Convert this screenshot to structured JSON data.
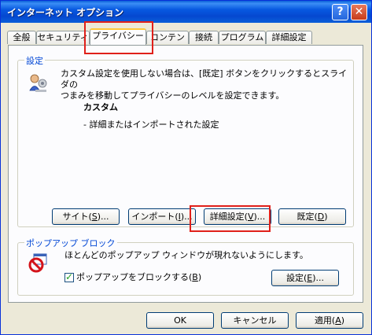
{
  "window": {
    "title": "インターネット オプション"
  },
  "titlebar": {
    "help": "?",
    "close": "✕"
  },
  "tabs": [
    {
      "label": "全般"
    },
    {
      "label": "セキュリティ"
    },
    {
      "label": "プライバシー"
    },
    {
      "label": "コンテンツ"
    },
    {
      "label": "接続"
    },
    {
      "label": "プログラム"
    },
    {
      "label": "詳細設定"
    }
  ],
  "settings": {
    "group_label": "設定",
    "description_line1": "カスタム設定を使用しない場合は、[既定] ボタンをクリックするとスライダの",
    "description_line2": "つまみを移動してプライバシーのレベルを設定できます。",
    "level_title": "カスタム",
    "level_detail": "- 詳細またはインポートされた設定",
    "buttons": {
      "sites": {
        "text": "サイト(",
        "key": "S",
        "end": ")..."
      },
      "import": {
        "text": "インポート(",
        "key": "I",
        "end": ")..."
      },
      "advanced": {
        "text": "詳細設定(",
        "key": "V",
        "end": ")..."
      },
      "default": {
        "text": "既定(",
        "key": "D",
        "end": ")"
      }
    }
  },
  "popup": {
    "group_label": "ポップアップ ブロック",
    "description": "ほとんどのポップアップ ウィンドウが現れないようにします。",
    "checkbox": {
      "text": "ポップアップをブロックする(",
      "key": "B",
      "end": ")",
      "checked": true
    },
    "settings_button": {
      "text": "設定(",
      "key": "E",
      "end": ")..."
    }
  },
  "footer": {
    "ok": "OK",
    "cancel": {
      "text": "キャンセル"
    },
    "apply": {
      "text": "適用(",
      "key": "A",
      "end": ")"
    }
  }
}
